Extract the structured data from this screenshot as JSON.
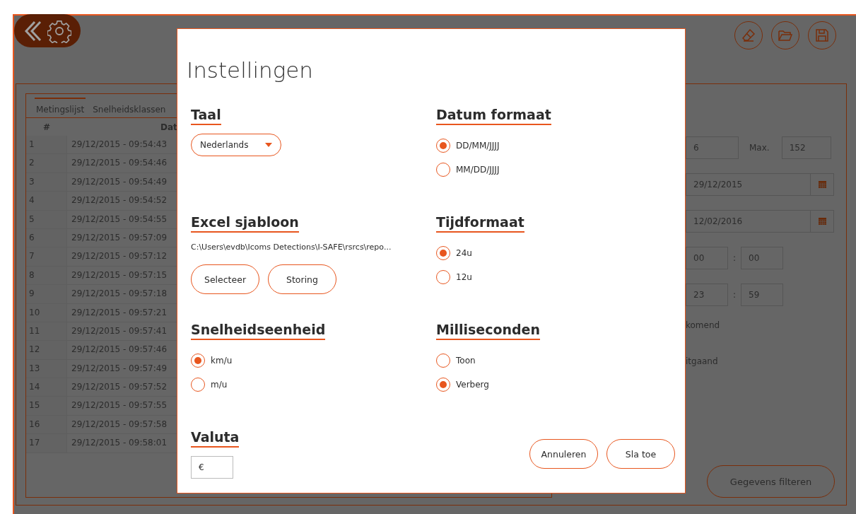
{
  "table": {
    "tabs": [
      {
        "label": "Metingslijst",
        "selected": true
      },
      {
        "label": "Snelheidsklassen",
        "selected": false
      }
    ],
    "columns": [
      "#",
      "Dat"
    ],
    "rows": [
      [
        "1",
        "29/12/2015 - 09:54:43"
      ],
      [
        "2",
        "29/12/2015 - 09:54:46"
      ],
      [
        "3",
        "29/12/2015 - 09:54:49"
      ],
      [
        "4",
        "29/12/2015 - 09:54:52"
      ],
      [
        "5",
        "29/12/2015 - 09:54:55"
      ],
      [
        "6",
        "29/12/2015 - 09:57:09"
      ],
      [
        "7",
        "29/12/2015 - 09:57:12"
      ],
      [
        "8",
        "29/12/2015 - 09:57:15"
      ],
      [
        "9",
        "29/12/2015 - 09:57:18"
      ],
      [
        "10",
        "29/12/2015 - 09:57:21"
      ],
      [
        "11",
        "29/12/2015 - 09:57:41"
      ],
      [
        "12",
        "29/12/2015 - 09:57:46"
      ],
      [
        "13",
        "29/12/2015 - 09:57:49"
      ],
      [
        "14",
        "29/12/2015 - 09:57:52"
      ],
      [
        "15",
        "29/12/2015 - 09:57:55"
      ],
      [
        "16",
        "29/12/2015 - 09:57:58"
      ],
      [
        "17",
        "29/12/2015 - 09:58:01"
      ]
    ]
  },
  "filters": {
    "min": "6",
    "max_label": "Max.",
    "max": "152",
    "start_date": "29/12/2015",
    "end_date": "12/02/2016",
    "start_time": {
      "hours": "00",
      "separator": ":",
      "minutes": "00"
    },
    "end_time": {
      "hours": "23",
      "separator": ":",
      "minutes": "59"
    },
    "direction_1": "komend",
    "direction_2": "itgaand",
    "filter_button": "Gegevens filteren"
  },
  "dialog": {
    "title": "Instellingen",
    "sections": [
      {
        "kind": "dropdown",
        "heading": "Taal",
        "value": "Nederlands"
      },
      {
        "kind": "radio",
        "heading": "Datum formaat",
        "options": [
          {
            "label": "DD/MM/JJJJ",
            "selected": true
          },
          {
            "label": "MM/DD/JJJJ",
            "selected": false
          }
        ]
      },
      {
        "kind": "file",
        "heading": "Excel sjabloon",
        "path": "C:\\Users\\evdb\\Icoms Detections\\I-SAFE\\rsrcs\\repo...",
        "buttons": [
          "Selecteer",
          "Storing"
        ]
      },
      {
        "kind": "radio",
        "heading": "Tijdformaat",
        "options": [
          {
            "label": "24u",
            "selected": true
          },
          {
            "label": "12u",
            "selected": false
          }
        ]
      },
      {
        "kind": "radio",
        "heading": "Snelheidseenheid",
        "options": [
          {
            "label": "km/u",
            "selected": true
          },
          {
            "label": "m/u",
            "selected": false
          }
        ]
      },
      {
        "kind": "radio",
        "heading": "Milliseconden",
        "options": [
          {
            "label": "Toon",
            "selected": false
          },
          {
            "label": "Verberg",
            "selected": true
          }
        ]
      },
      {
        "kind": "input",
        "heading": "Valuta",
        "value": "€"
      }
    ],
    "buttons": [
      "Annuleren",
      "Sla toe"
    ]
  }
}
